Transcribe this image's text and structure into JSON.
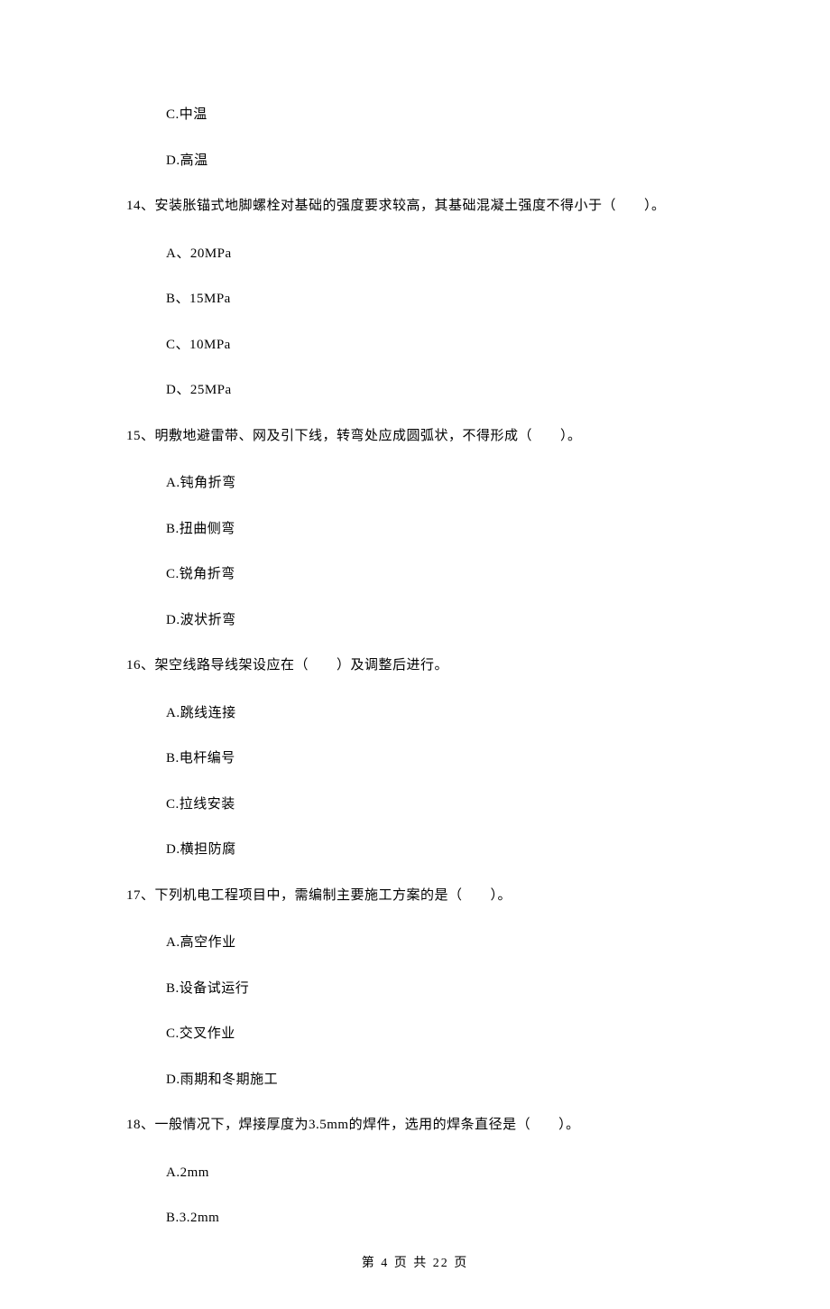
{
  "topOptions": {
    "c": "C.中温",
    "d": "D.高温"
  },
  "q14": {
    "text": "14、安装胀锚式地脚螺栓对基础的强度要求较高，其基础混凝土强度不得小于（　　）。",
    "a": "A、20MPa",
    "b": "B、15MPa",
    "c": "C、10MPa",
    "d": "D、25MPa"
  },
  "q15": {
    "text": "15、明敷地避雷带、网及引下线，转弯处应成圆弧状，不得形成（　　）。",
    "a": "A.钝角折弯",
    "b": "B.扭曲侧弯",
    "c": "C.锐角折弯",
    "d": "D.波状折弯"
  },
  "q16": {
    "text": "16、架空线路导线架设应在（　　）及调整后进行。",
    "a": "A.跳线连接",
    "b": "B.电杆编号",
    "c": "C.拉线安装",
    "d": "D.横担防腐"
  },
  "q17": {
    "text": "17、下列机电工程项目中，需编制主要施工方案的是（　　）。",
    "a": "A.高空作业",
    "b": "B.设备试运行",
    "c": "C.交叉作业",
    "d": "D.雨期和冬期施工"
  },
  "q18": {
    "text": "18、一般情况下，焊接厚度为3.5mm的焊件，选用的焊条直径是（　　）。",
    "a": "A.2mm",
    "b": "B.3.2mm"
  },
  "footer": "第 4 页 共 22 页"
}
